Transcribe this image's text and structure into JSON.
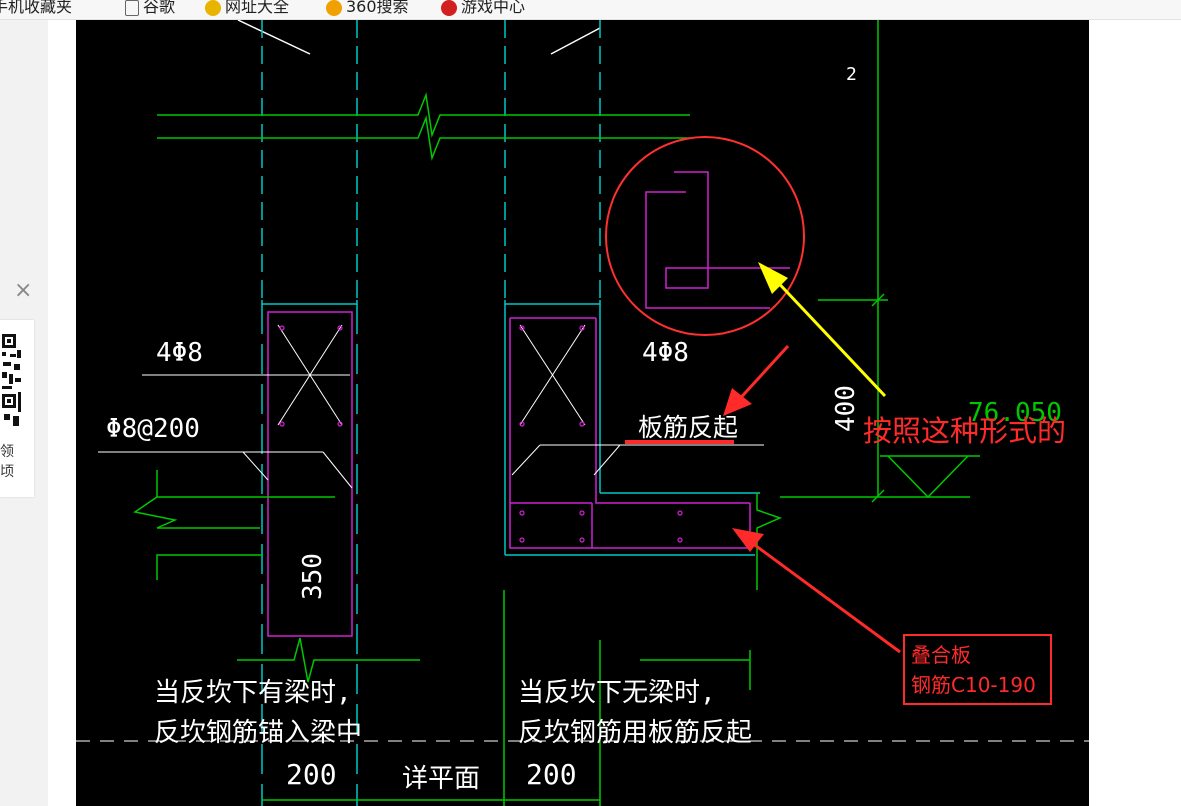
{
  "bookmarks": [
    {
      "label": "手机收藏夹",
      "icon": "folder-icon"
    },
    {
      "label": "谷歌",
      "icon": "page-icon"
    },
    {
      "label": "网址大全",
      "icon": "nav-site-icon"
    },
    {
      "label": "360搜索",
      "icon": "search-engine-icon"
    },
    {
      "label": "游戏中心",
      "icon": "game-center-icon"
    }
  ],
  "side_panel": {
    "close": "×",
    "text": "领\n顷"
  },
  "cad": {
    "labels": {
      "left_rebar": "4Φ8",
      "right_rebar": "4Φ8",
      "stirrup": "Φ8@200",
      "slab_bar_up": "板筋反起",
      "dim_350": "350",
      "dim_400": "400",
      "elev_number": "76.050",
      "top_number": "2",
      "note_left_1": "当反坎下有梁时,",
      "note_left_2": "反坎钢筋锚入梁中",
      "note_right_1": "当反坎下无梁时,",
      "note_right_2": "反坎钢筋用板筋反起",
      "dim_200_left": "200",
      "dim_200_right": "200",
      "detail_plan": "详平面"
    },
    "colors": {
      "background": "#000000",
      "cyan": "#00c8c8",
      "green": "#00c800",
      "magenta": "#d020d0",
      "white": "#ffffff",
      "red": "#ff2a2a",
      "yellow": "#ffff00"
    }
  },
  "annotations": {
    "big_note": "按照这种形式的",
    "box_line1": "叠合板",
    "box_line2": "钢筋C10-190"
  }
}
